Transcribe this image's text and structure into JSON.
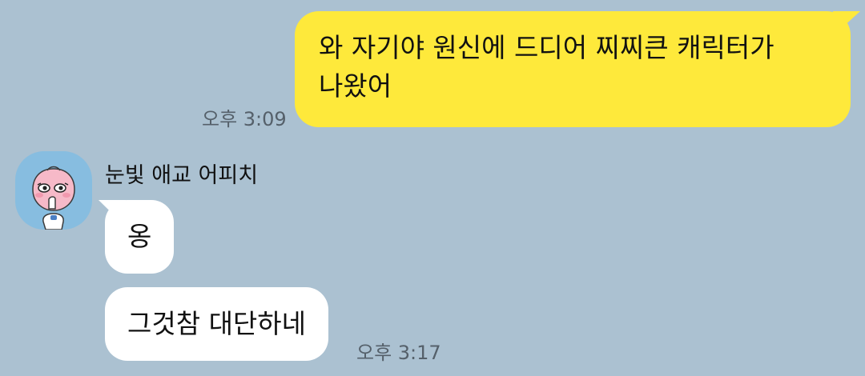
{
  "chat": {
    "messages": [
      {
        "direction": "outgoing",
        "text": "와 자기야 원신에 드디어 찌찌큰 캐릭터가\n나왔어",
        "time": "오후 3:09"
      },
      {
        "direction": "incoming",
        "sender": "눈빛 애교 어피치",
        "avatar_icon": "apeach-avatar-icon",
        "text": "옹"
      },
      {
        "direction": "incoming",
        "sender": "눈빛 애교 어피치",
        "text": "그것참 대단하네",
        "time": "오후 3:17"
      }
    ]
  },
  "colors": {
    "background": "#abc1d1",
    "outgoing_bubble": "#fee93b",
    "incoming_bubble": "#ffffff",
    "timestamp": "#55606a",
    "avatar_background": "#87bde0"
  }
}
